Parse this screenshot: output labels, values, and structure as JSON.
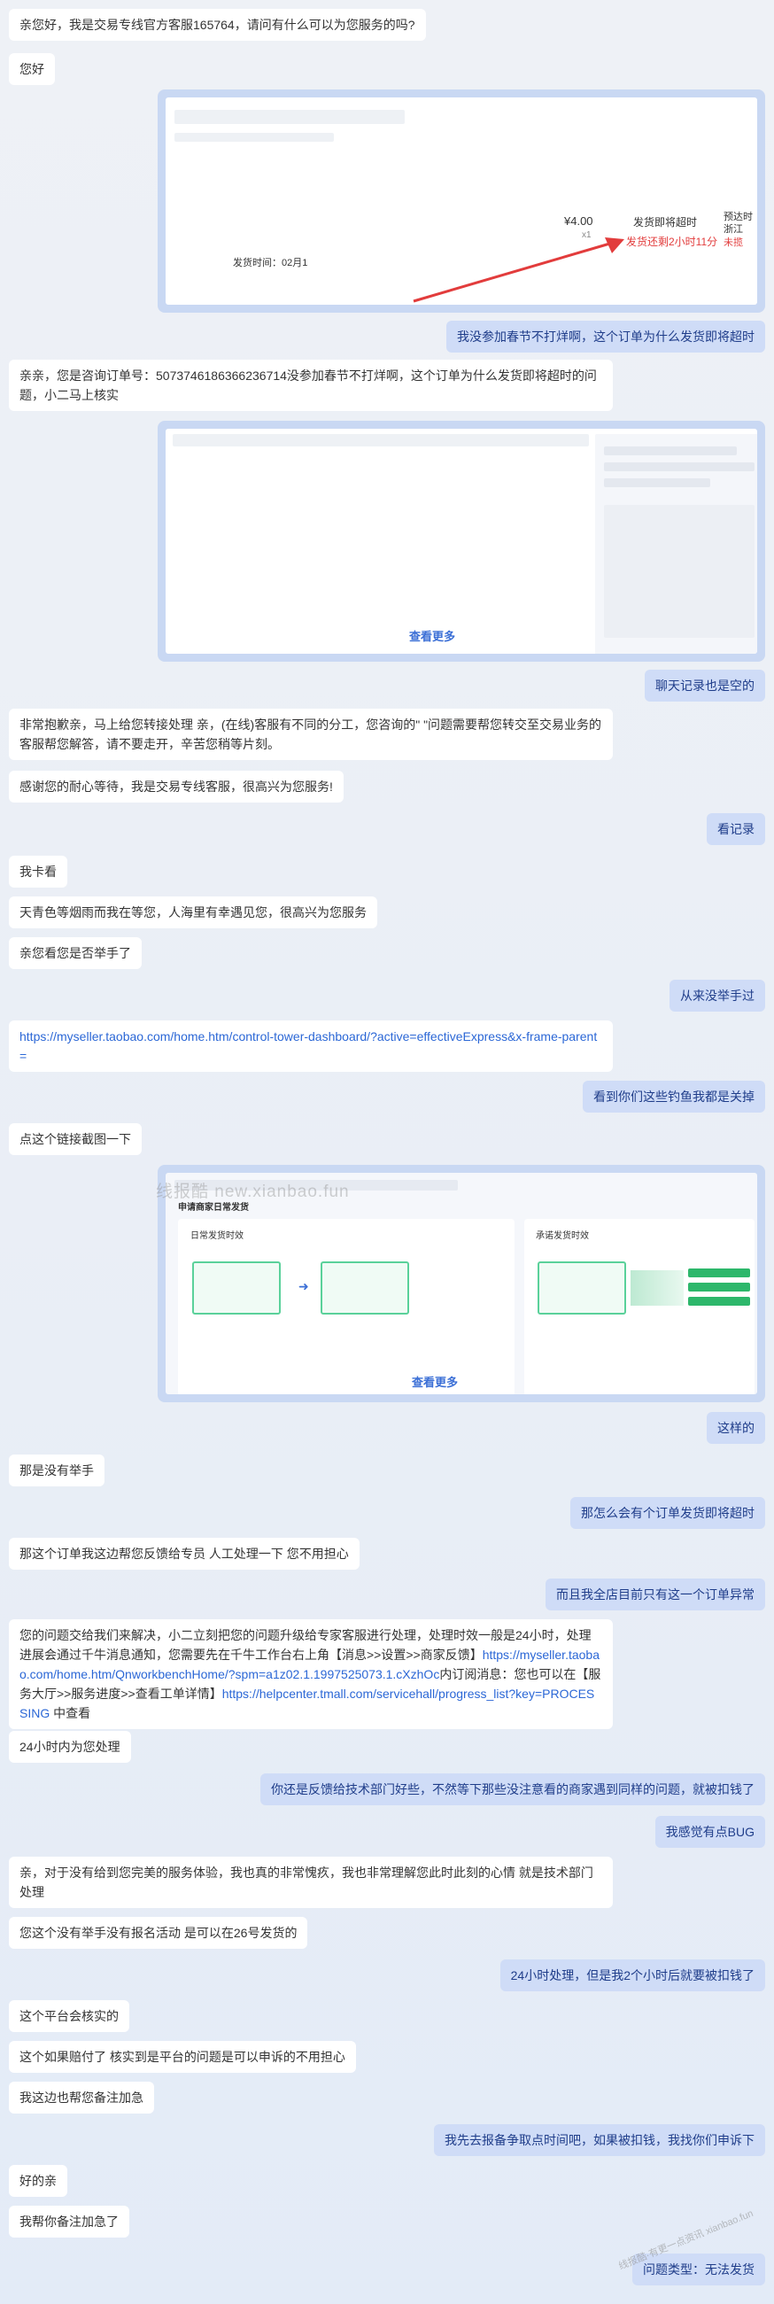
{
  "messages": [
    {
      "t": "亲您好，我是交易专线官方客服165764，请问有什么可以为您服务的吗?"
    },
    {
      "t": "您好"
    },
    {
      "t": "我没参加春节不打烊啊，这个订单为什么发货即将超时"
    },
    {
      "t": "亲亲，您是咨询订单号：5073746186366236714没参加春节不打烊啊，这个订单为什么发货即将超时的问题，小二马上核实"
    },
    {
      "t": "聊天记录也是空的"
    },
    {
      "t": "非常抱歉亲，马上给您转接处理 亲，(在线)客服有不同的分工，您咨询的\" \"问题需要帮您转交至交易业务的客服帮您解答，请不要走开，辛苦您稍等片刻。"
    },
    {
      "t": "感谢您的耐心等待，我是交易专线客服，很高兴为您服务!"
    },
    {
      "t": "看记录"
    },
    {
      "t": "我卡看"
    },
    {
      "t": "天青色等烟雨而我在等您，人海里有幸遇见您，很高兴为您服务"
    },
    {
      "t": "亲您看您是否举手了"
    },
    {
      "t": "从来没举手过"
    },
    {
      "t": "https://myseller.taobao.com/home.htm/control-tower-dashboard/?active=effectiveExpress&x-frame-parent="
    },
    {
      "t": "看到你们这些钓鱼我都是关掉"
    },
    {
      "t": "点这个链接截图一下"
    },
    {
      "t": "这样的"
    },
    {
      "t": "那是没有举手"
    },
    {
      "t": "那怎么会有个订单发货即将超时"
    },
    {
      "t": "那这个订单我这边帮您反馈给专员 人工处理一下 您不用担心"
    },
    {
      "t": "而且我全店目前只有这一个订单异常"
    },
    {
      "t1": "您的问题交给我们来解决，小二立刻把您的问题升级给专家客服进行处理，处理时效一般是24小时，处理进展会通过千牛消息通知，您需要先在千牛工作台右上角【消息>>设置>>商家反馈】",
      "l1": "https://myseller.taobao.com/home.htm/QnworkbenchHome/?spm=a1z02.1.1997525073.1.cXzhOc",
      "t2": "内订阅消息：您也可以在【服务大厅>>服务进度>>查看工单详情】",
      "l2": "https://helpcenter.tmall.com/servicehall/progress_list?key=PROCESSING",
      "t3": " 中查看"
    },
    {
      "t": "24小时内为您处理"
    },
    {
      "t": "你还是反馈给技术部门好些，不然等下那些没注意看的商家遇到同样的问题，就被扣钱了"
    },
    {
      "t": "我感觉有点BUG"
    },
    {
      "t": "亲，对于没有给到您完美的服务体验，我也真的非常愧疚，我也非常理解您此时此刻的心情 就是技术部门处理"
    },
    {
      "t": "您这个没有举手没有报名活动 是可以在26号发货的"
    },
    {
      "t": "24小时处理，但是我2个小时后就要被扣钱了"
    },
    {
      "t": "这个平台会核实的"
    },
    {
      "t": "这个如果赔付了 核实到是平台的问题是可以申诉的不用担心"
    },
    {
      "t": "我这边也帮您备注加急"
    },
    {
      "t": "我先去报备争取点时间吧，如果被扣钱，我找你们申诉下"
    },
    {
      "t": "好的亲"
    },
    {
      "t": "我帮你备注加急了"
    },
    {
      "t": "问题类型：无法发货"
    }
  ],
  "img1": {
    "price": "¥4.00",
    "qty": "x1",
    "status": "发货即将超时",
    "countdown": "发货还剩2小时11分",
    "ship_time": "发货时间：02月1",
    "side1": "预达时",
    "side2": "浙江",
    "side3": "未揽"
  },
  "img2": {
    "more": "查看更多"
  },
  "img3": {
    "more": "查看更多",
    "title": "申请商家日常发货",
    "box1": "日常发货时效",
    "box2": "承诺发货时效"
  },
  "watermark": "线报酷 new.xianbao.fun",
  "watermark2": "线报酷·有更一点资讯\nxianbao.fun"
}
